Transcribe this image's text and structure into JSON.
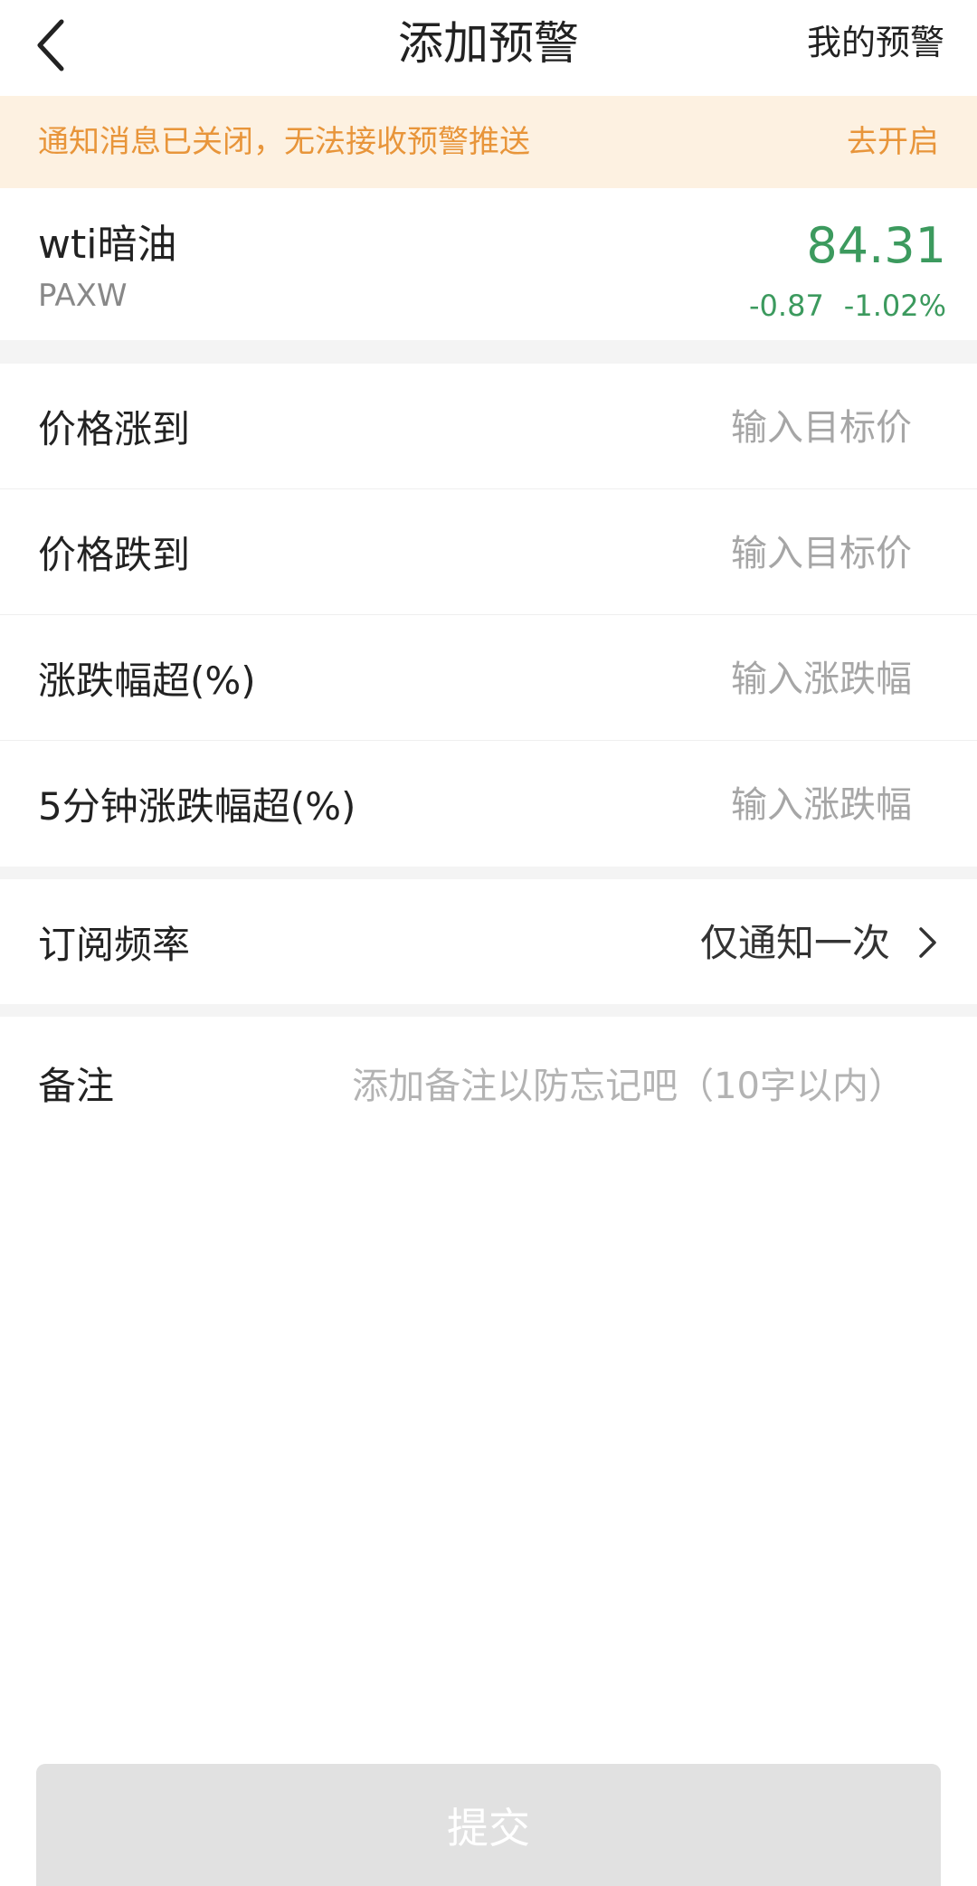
{
  "header": {
    "title": "添加预警",
    "my_alerts_label": "我的预警",
    "back_icon": "chevron-left-icon"
  },
  "notice": {
    "text": "通知消息已关闭，无法接收预警推送",
    "action_label": "去开启",
    "color": "#e8953a",
    "background": "#fdf1e1"
  },
  "quote": {
    "name": "wti暗油",
    "code": "PAXW",
    "price": "84.31",
    "change": "-0.87",
    "change_percent": "-1.02%",
    "color": "#3c9a5e"
  },
  "conditions": [
    {
      "label": "价格涨到",
      "placeholder": "输入目标价",
      "value": ""
    },
    {
      "label": "价格跌到",
      "placeholder": "输入目标价",
      "value": ""
    },
    {
      "label": "涨跌幅超(%)",
      "placeholder": "输入涨跌幅",
      "value": ""
    },
    {
      "label": "5分钟涨跌幅超(%)",
      "placeholder": "输入涨跌幅",
      "value": ""
    }
  ],
  "frequency": {
    "label": "订阅频率",
    "value": "仅通知一次",
    "icon": "chevron-right-icon"
  },
  "note": {
    "label": "备注",
    "placeholder": "添加备注以防忘记吧（10字以内）",
    "value": ""
  },
  "submit": {
    "label": "提交",
    "background": "#e1e1e1"
  }
}
